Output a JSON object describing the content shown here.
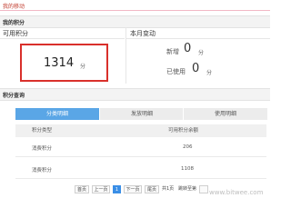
{
  "breadcrumb": "我的移动",
  "points_section": {
    "title": "我的积分"
  },
  "available_card": {
    "title": "可用积分",
    "value": "1314",
    "unit": "分"
  },
  "monthly_card": {
    "title": "本月变动",
    "added_label": "新增",
    "added_value": "0",
    "added_unit": "分",
    "used_label": "已使用",
    "used_value": "0",
    "used_unit": "分"
  },
  "query_section": {
    "title": "积分查询"
  },
  "tabs": [
    {
      "label": "分类明细",
      "active": true
    },
    {
      "label": "发放明细",
      "active": false
    },
    {
      "label": "使用明细",
      "active": false
    }
  ],
  "table": {
    "headers": [
      "积分类型",
      "可用积分余额"
    ],
    "rows": [
      {
        "type": "消费积分",
        "balance": "206"
      },
      {
        "type": "消费积分",
        "balance": "1108"
      }
    ]
  },
  "pagination": {
    "first": "首页",
    "prev": "上一页",
    "current": "1",
    "next": "下一页",
    "last": "尾页",
    "total": "共1页",
    "goto_label": "跳转至第"
  },
  "watermark": "www.bitwee.com",
  "colors": {
    "accent_blue": "#5aa6e6",
    "highlight_red": "#d9302b",
    "crumb_red": "#c0392b"
  }
}
